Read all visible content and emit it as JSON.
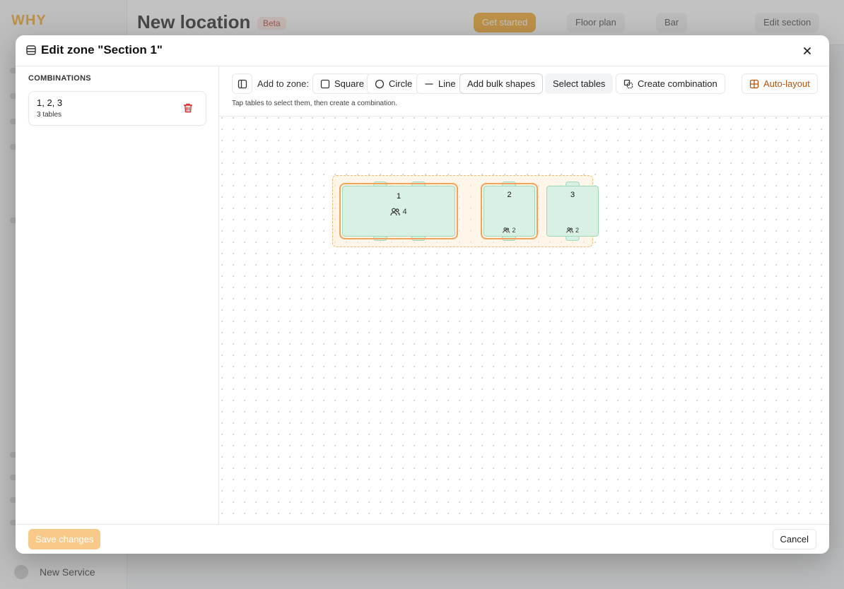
{
  "background": {
    "logo": "WHY",
    "page_title": "New location",
    "badge": "Beta",
    "header_buttons": [
      "Get started",
      "Floor plan",
      "Bar",
      "Edit section"
    ],
    "bottom_item": "New Service"
  },
  "dialog": {
    "title": "Edit zone \"Section 1\"",
    "combinations_heading": "COMBINATIONS",
    "combinations": [
      {
        "name": "1, 2, 3",
        "count": "3 tables"
      }
    ],
    "toolbar": {
      "add_to_zone": "Add to zone:",
      "square": "Square",
      "circle": "Circle",
      "line": "Line",
      "add_bulk": "Add bulk shapes",
      "select_tables": "Select tables",
      "create_combination": "Create combination",
      "auto_layout": "Auto-layout",
      "hint": "Tap tables to select them, then create a combination."
    },
    "tables": [
      {
        "number": "1",
        "capacity": "4",
        "selected": true
      },
      {
        "number": "2",
        "capacity": "2",
        "selected": true
      },
      {
        "number": "3",
        "capacity": "2",
        "selected": false
      }
    ],
    "footer": {
      "save": "Save changes",
      "cancel": "Cancel"
    }
  },
  "colors": {
    "accent": "#f5a623",
    "table_fill": "#d8f1e4",
    "table_border": "#9fd8b6",
    "selection": "#f0a35a",
    "delete": "#dc2626"
  }
}
